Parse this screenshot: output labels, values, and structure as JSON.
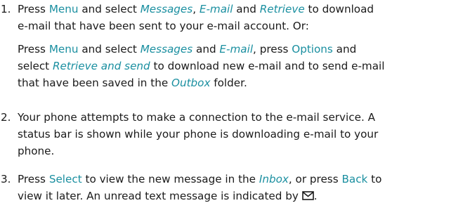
{
  "steps": [
    {
      "number": "1.",
      "paragraphs": [
        [
          [
            {
              "t": "Press ",
              "s": "n"
            },
            {
              "t": "Menu",
              "s": "k"
            },
            {
              "t": " and select ",
              "s": "n"
            },
            {
              "t": "Messages",
              "s": "i"
            },
            {
              "t": ", ",
              "s": "n"
            },
            {
              "t": "E-mail",
              "s": "i"
            },
            {
              "t": " and ",
              "s": "n"
            },
            {
              "t": "Retrieve",
              "s": "i"
            },
            {
              "t": " to download",
              "s": "n"
            }
          ],
          [
            {
              "t": "e-mail that have been sent to your e-mail account. Or:",
              "s": "n"
            }
          ]
        ],
        [
          [
            {
              "t": "Press ",
              "s": "n"
            },
            {
              "t": "Menu",
              "s": "k"
            },
            {
              "t": " and select ",
              "s": "n"
            },
            {
              "t": "Messages",
              "s": "i"
            },
            {
              "t": " and ",
              "s": "n"
            },
            {
              "t": "E-mail",
              "s": "i"
            },
            {
              "t": ", press ",
              "s": "n"
            },
            {
              "t": "Options",
              "s": "k"
            },
            {
              "t": " and",
              "s": "n"
            }
          ],
          [
            {
              "t": "select ",
              "s": "n"
            },
            {
              "t": "Retrieve and send",
              "s": "i"
            },
            {
              "t": " to download new e-mail and to send e-mail",
              "s": "n"
            }
          ],
          [
            {
              "t": "that have been saved in the ",
              "s": "n"
            },
            {
              "t": "Outbox",
              "s": "i"
            },
            {
              "t": " folder.",
              "s": "n"
            }
          ]
        ]
      ]
    },
    {
      "number": "2.",
      "paragraphs": [
        [
          [
            {
              "t": "Your phone attempts to make a connection to the e-mail service. A",
              "s": "n"
            }
          ],
          [
            {
              "t": "status bar is shown while your phone is downloading e-mail to your",
              "s": "n"
            }
          ],
          [
            {
              "t": "phone.",
              "s": "n"
            }
          ]
        ]
      ]
    },
    {
      "number": "3.",
      "paragraphs": [
        [
          [
            {
              "t": "Press ",
              "s": "n"
            },
            {
              "t": "Select",
              "s": "k"
            },
            {
              "t": " to view the new message in the ",
              "s": "n"
            },
            {
              "t": "Inbox",
              "s": "i"
            },
            {
              "t": ", or press ",
              "s": "n"
            },
            {
              "t": "Back",
              "s": "k"
            },
            {
              "t": " to",
              "s": "n"
            }
          ],
          [
            {
              "t": "view it later. An unread text message is indicated by ",
              "s": "n"
            },
            {
              "icon": "unread-message-envelope-icon"
            },
            {
              "t": ".",
              "s": "n"
            }
          ]
        ]
      ]
    }
  ]
}
